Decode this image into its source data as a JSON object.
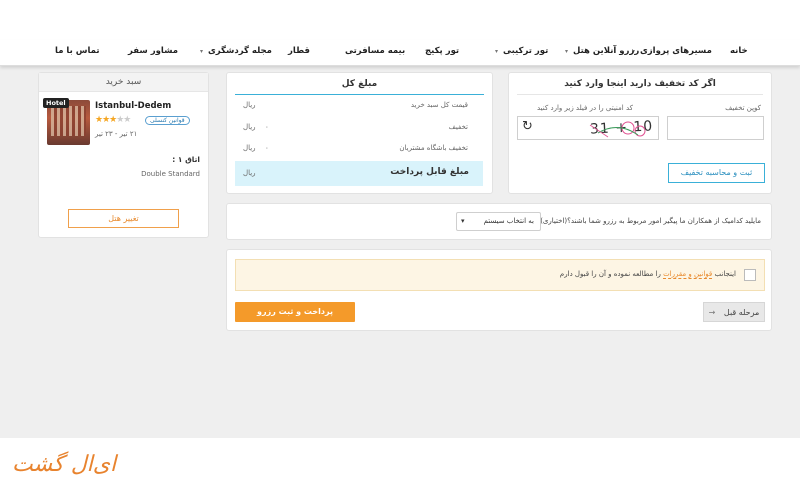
{
  "nav": {
    "items": [
      {
        "label": "خانه"
      },
      {
        "label": "مسیرهای پروازی"
      },
      {
        "label": "رزرو آنلاین هتل"
      },
      {
        "label": "تور ترکیبی"
      },
      {
        "label": "تور پکیج"
      },
      {
        "label": "بیمه مسافرتی"
      },
      {
        "label": "قطار"
      },
      {
        "label": "مجله گردشگری"
      },
      {
        "label": "مشاور سفر"
      },
      {
        "label": "تماس با ما"
      }
    ],
    "dropdown_chevron": "▾"
  },
  "cart": {
    "title": "سبد خرید",
    "hotel_badge": "Hotel",
    "hotel_name": "Istanbul-Dedem",
    "stars_filled": "★★★",
    "stars_empty": "★★",
    "rules_link": "قوانین کنسلی",
    "dates": "۲۱ تیر - ۲۳ تیر",
    "room_label": "اتاق ۱ :",
    "room_type": "Double Standard",
    "change_hotel_button": "تغییر هتل"
  },
  "totals": {
    "title": "مبلغ کل",
    "rows": [
      {
        "label": "قیمت کل سبد خرید",
        "value": "",
        "unit": "ریال"
      },
      {
        "label": "تخفیف",
        "value": "۰",
        "unit": "ریال"
      },
      {
        "label": "تخفیف باشگاه مشتریان",
        "value": "۰",
        "unit": "ریال"
      }
    ],
    "payable_label": "مبلغ قابل پرداخت",
    "payable_unit": "ریال"
  },
  "discount": {
    "title": "اگر کد تخفیف دارید اینجا وارد کنید",
    "coupon_label": "کوپن تخفیف",
    "captcha_label": "کد امنیتی را در فیلد زیر وارد کنید",
    "captcha_text": "31 + 10",
    "refresh_icon": "↻",
    "submit_button": "ثبت و محاسبه تخفیف"
  },
  "colleague": {
    "question": "مایلید کدامیک از همکاران ما پیگیر امور مربوط به رزرو شما باشند؟(اختیاری)",
    "select_value": "به انتخاب سیستم",
    "select_arrow": "▾"
  },
  "agreement": {
    "prefix": "اینجانب",
    "link": "قوانین و مقررات",
    "suffix": "را مطالعه نموده و آن را قبول دارم"
  },
  "actions": {
    "pay_button": "پرداخت و ثبت رزرو",
    "back_button": "مرحله قبل",
    "back_arrow": "→"
  },
  "footer": {
    "logo_text": "ای‌ال گشت"
  }
}
